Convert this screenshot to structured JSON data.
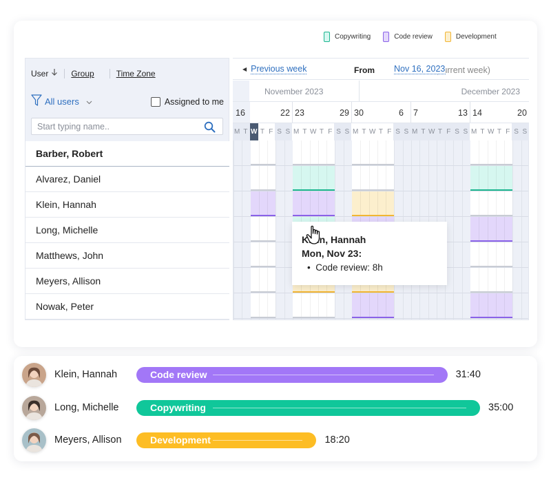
{
  "legend": [
    {
      "label": "Copywriting",
      "color": "#1bb58f",
      "fill": "#d6f7f0"
    },
    {
      "label": "Code review",
      "color": "#8a62e8",
      "fill": "#e3d7fb"
    },
    {
      "label": "Development",
      "color": "#f2b533",
      "fill": "#fcefcd"
    }
  ],
  "sort_bar": {
    "user": "User",
    "sort_icon": "arrow-down-icon",
    "group": "Group",
    "time_zone": "Time Zone"
  },
  "filter": {
    "all_users": "All users",
    "assigned_to_me": "Assigned to me",
    "assigned_checked": false
  },
  "search": {
    "placeholder": "Start typing name..",
    "value": ""
  },
  "users": [
    "Barber, Robert",
    "Alvarez, Daniel",
    "Klein, Hannah",
    "Long, Michelle",
    "Matthews, John",
    "Meyers, Allison",
    "Nowak, Peter"
  ],
  "nav": {
    "previous_week": "Previous week",
    "from_label": "From",
    "from_date": "Nov 16, 2023",
    "from_note": "(current week)"
  },
  "months": [
    "November 2023",
    "December 2023"
  ],
  "weeks": [
    {
      "start": "16",
      "end": "22"
    },
    {
      "start": "23",
      "end": "29"
    },
    {
      "start": "30",
      "end": "6"
    },
    {
      "start": "7",
      "end": "13"
    },
    {
      "start": "14",
      "end": "20"
    }
  ],
  "day_letters": [
    "M",
    "T",
    "W",
    "T",
    "F",
    "S",
    "S"
  ],
  "today_index": 2,
  "schedule": [
    [
      "white",
      "white",
      "white",
      null,
      "white"
    ],
    [
      "white",
      "green",
      "white",
      null,
      "green"
    ],
    [
      "purple",
      "purple",
      "yellow",
      null,
      "white"
    ],
    [
      "white",
      "green",
      "purple",
      null,
      "purple"
    ],
    [
      "white",
      "white",
      "white",
      null,
      "white"
    ],
    [
      "white",
      "yellow",
      "yellow",
      null,
      "white"
    ],
    [
      "white",
      "white",
      "purple",
      null,
      "purple"
    ]
  ],
  "tooltip": {
    "name": "Klein, Hannah",
    "date": "Mon, Nov 23:",
    "entry": "Code review: 8h"
  },
  "summary": [
    {
      "name": "Klein, Hannah",
      "task": "Code review",
      "time": "31:40",
      "color": "#a277f7",
      "fraction": 0.905
    },
    {
      "name": "Long, Michelle",
      "task": "Copywriting",
      "time": "35:00",
      "color": "#10c79a",
      "fraction": 1.0
    },
    {
      "name": "Meyers, Allison",
      "task": "Development",
      "time": "18:20",
      "color": "#fdbd24",
      "fraction": 0.524
    }
  ]
}
